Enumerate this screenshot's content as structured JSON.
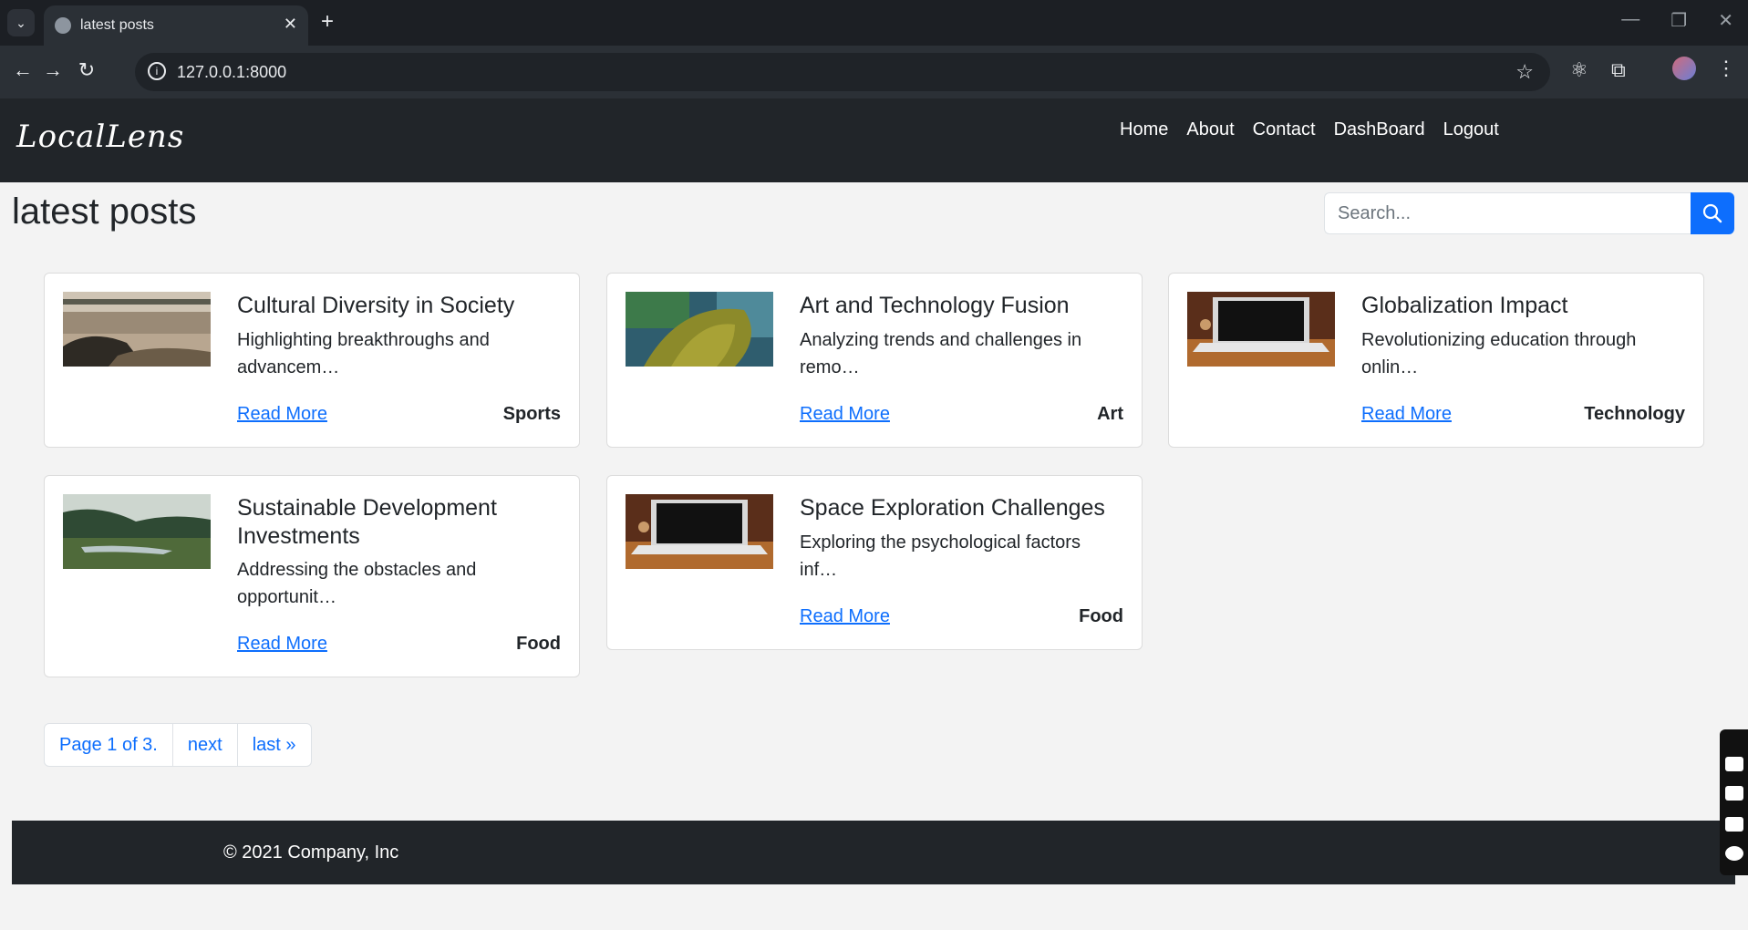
{
  "browser": {
    "tab_title": "latest posts",
    "url": "127.0.0.1:8000"
  },
  "site": {
    "brand": "LocalLens",
    "nav": [
      "Home",
      "About",
      "Contact",
      "DashBoard",
      "Logout"
    ]
  },
  "page": {
    "title": "latest posts",
    "search_placeholder": "Search..."
  },
  "posts": [
    {
      "title": "Cultural Diversity in Society",
      "excerpt": "Highlighting breakthroughs and advancem…",
      "category": "Sports",
      "link": "Read More"
    },
    {
      "title": "Art and Technology Fusion",
      "excerpt": "Analyzing trends and challenges in remo…",
      "category": "Art",
      "link": "Read More"
    },
    {
      "title": "Globalization Impact",
      "excerpt": "Revolutionizing education through onlin…",
      "category": "Technology",
      "link": "Read More"
    },
    {
      "title": "Sustainable Development Investments",
      "excerpt": "Addressing the obstacles and opportunit…",
      "category": "Food",
      "link": "Read More"
    },
    {
      "title": "Space Exploration Challenges",
      "excerpt": "Exploring the psychological factors inf…",
      "category": "Food",
      "link": "Read More"
    }
  ],
  "pagination": {
    "current": "Page 1 of 3.",
    "next": "next",
    "last": "last »"
  },
  "footer": {
    "text": "© 2021 Company, Inc"
  }
}
